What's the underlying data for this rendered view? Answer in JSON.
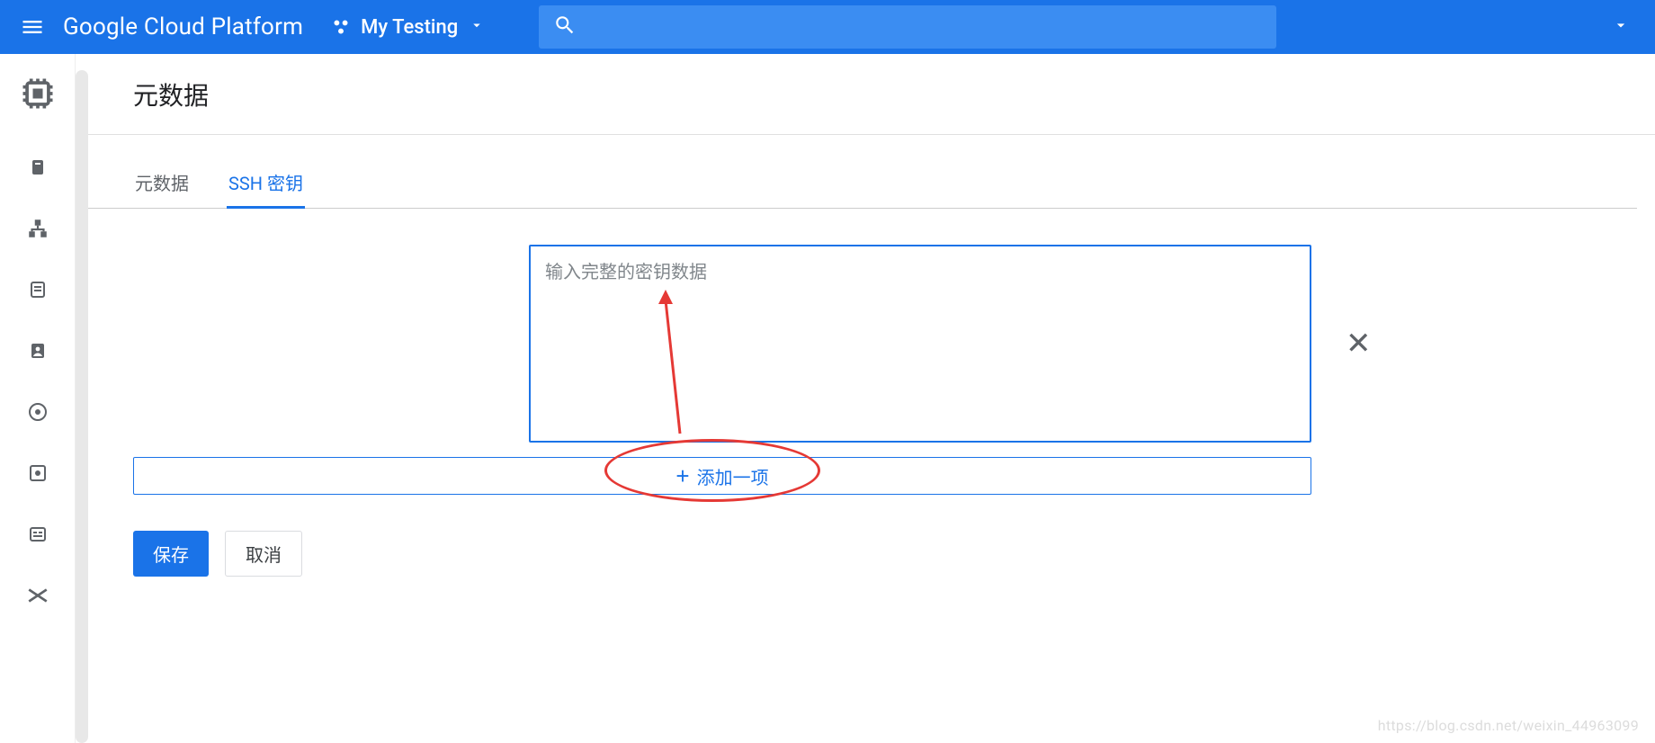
{
  "header": {
    "brand": "Google Cloud Platform",
    "project_name": "My Testing"
  },
  "page": {
    "title": "元数据"
  },
  "tabs": [
    {
      "label": "元数据",
      "active": false
    },
    {
      "label": "SSH 密钥",
      "active": true
    }
  ],
  "ssh": {
    "key_placeholder": "输入完整的密钥数据",
    "key_value": "",
    "add_label": "添加一项"
  },
  "actions": {
    "save_label": "保存",
    "cancel_label": "取消"
  },
  "watermark": "https://blog.csdn.net/weixin_44963099"
}
